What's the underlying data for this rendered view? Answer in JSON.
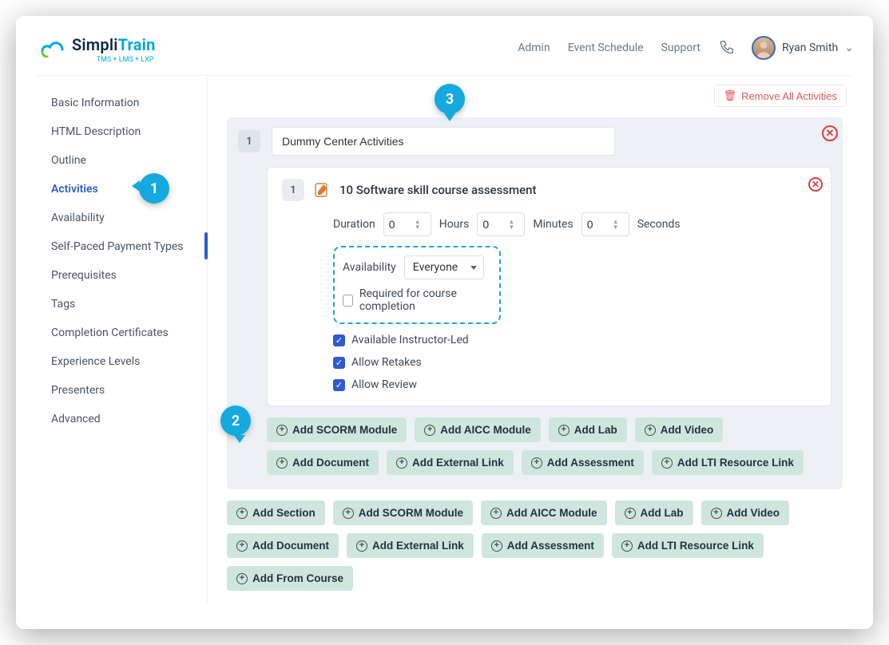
{
  "brand": {
    "name_plain": "Simpli",
    "name_accent": "Train",
    "sub": "TMS + LMS + LXP"
  },
  "nav": {
    "links": [
      "Admin",
      "Event Schedule",
      "Support"
    ],
    "user": "Ryan Smith"
  },
  "sidebar": {
    "items": [
      "Basic Information",
      "HTML Description",
      "Outline",
      "Activities",
      "Availability",
      "Self-Paced Payment Types",
      "Prerequisites",
      "Tags",
      "Completion Certificates",
      "Experience Levels",
      "Presenters",
      "Advanced"
    ],
    "active_index": 3
  },
  "remove_all": "Remove All Activities",
  "section": {
    "index": "1",
    "title": "Dummy Center Activities"
  },
  "activity": {
    "index": "1",
    "title": "10 Software skill course assessment",
    "duration_label": "Duration",
    "hours_label": "Hours",
    "minutes_label": "Minutes",
    "seconds_label": "Seconds",
    "hours": "0",
    "minutes": "0",
    "seconds": "0",
    "availability_label": "Availability",
    "availability_value": "Everyone",
    "checks": [
      {
        "label": "Required for course completion",
        "checked": false
      },
      {
        "label": "Available Instructor-Led",
        "checked": true
      },
      {
        "label": "Allow Retakes",
        "checked": true
      },
      {
        "label": "Allow Review",
        "checked": true
      }
    ]
  },
  "inner_buttons": [
    "Add SCORM Module",
    "Add AICC Module",
    "Add Lab",
    "Add Video",
    "Add Document",
    "Add External Link",
    "Add Assessment",
    "Add LTI Resource Link"
  ],
  "outer_buttons": [
    "Add Section",
    "Add SCORM Module",
    "Add AICC Module",
    "Add Lab",
    "Add Video",
    "Add Document",
    "Add External Link",
    "Add Assessment",
    "Add LTI Resource Link",
    "Add From Course"
  ],
  "callouts": {
    "c1": "1",
    "c2": "2",
    "c3": "3"
  }
}
